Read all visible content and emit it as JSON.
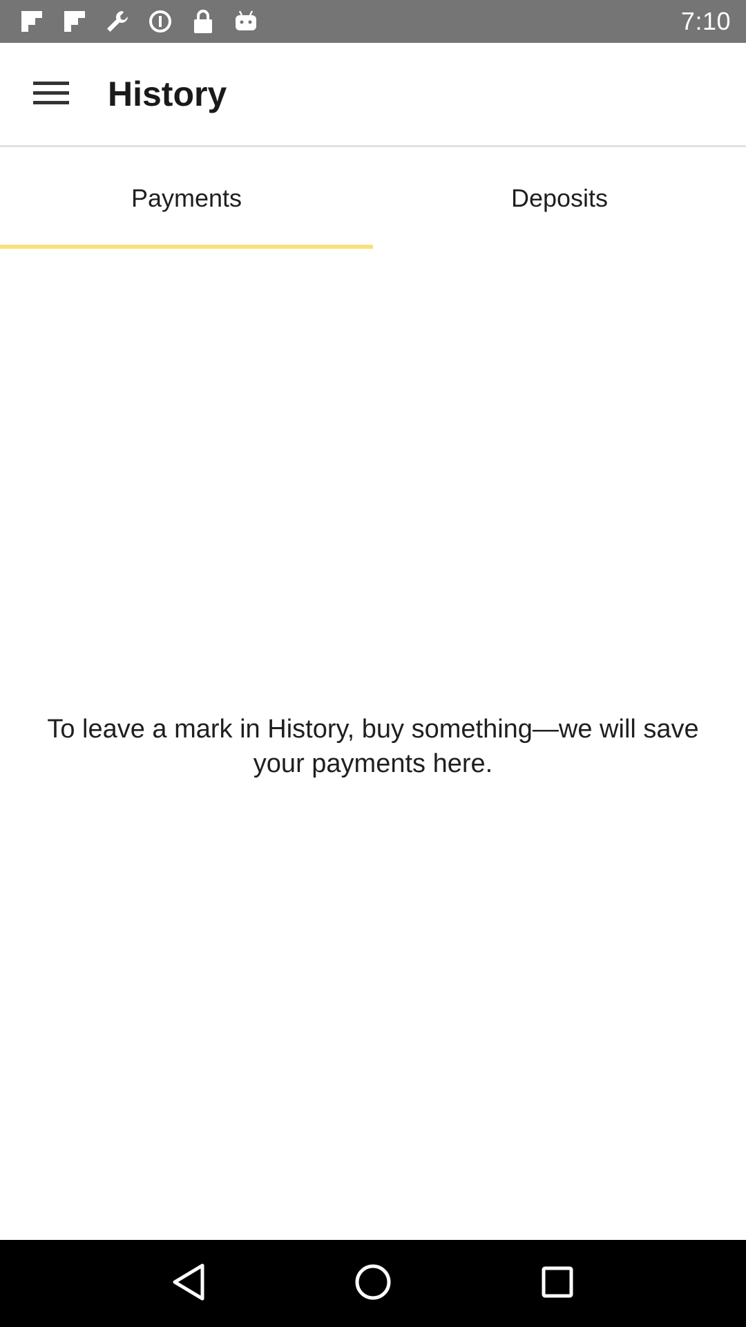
{
  "status_bar": {
    "time": "7:10",
    "icons": [
      "flipboard-icon",
      "flipboard-icon",
      "wrench-icon",
      "data-saver-icon",
      "lock-icon",
      "android-icon",
      "wifi-icon",
      "signal-icon",
      "battery-icon"
    ],
    "background": "#757575"
  },
  "app_bar": {
    "title": "History",
    "menu_icon": "hamburger-menu-icon"
  },
  "tabs": {
    "items": [
      {
        "label": "Payments",
        "selected": true
      },
      {
        "label": "Deposits",
        "selected": false
      }
    ],
    "indicator_color": "#f7e27a"
  },
  "empty_state": {
    "message": "To leave a mark in History, buy something—we will save your payments here."
  },
  "nav_bar": {
    "icons": [
      "back-triangle-icon",
      "home-circle-icon",
      "recents-square-icon"
    ],
    "background": "#000000"
  }
}
